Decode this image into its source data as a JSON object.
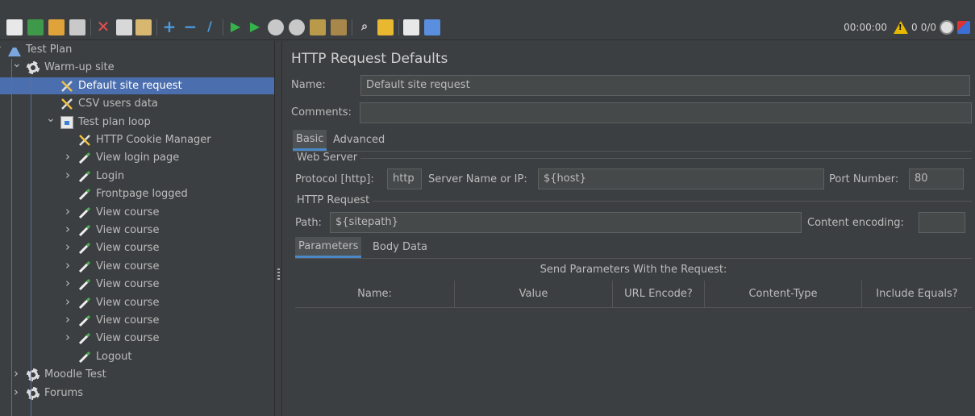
{
  "toolbar": {
    "buttons": [
      "new-icon",
      "templates-icon",
      "open-icon",
      "save-icon",
      "cut-icon",
      "copy-icon",
      "paste-icon",
      "expand-icon",
      "collapse-icon",
      "toggle-icon",
      "start-icon",
      "start-no-pause-icon",
      "stop-icon",
      "shutdown-icon",
      "clear-icon",
      "clear-all-icon",
      "search-icon",
      "reset-search-icon",
      "function-helper-icon",
      "help-icon"
    ],
    "timer": "00:00:00",
    "warnings": "0",
    "threads": "0/0"
  },
  "tree": {
    "items": [
      {
        "label": "Test Plan",
        "icon": "flask-icon",
        "level": 0,
        "arrow": "down"
      },
      {
        "label": "Warm-up site",
        "icon": "gear-icon",
        "level": 1,
        "arrow": "down"
      },
      {
        "label": "Default site request",
        "icon": "tools-icon",
        "level": 2,
        "arrow": "",
        "selected": true
      },
      {
        "label": "CSV users data",
        "icon": "tools-icon",
        "level": 2,
        "arrow": ""
      },
      {
        "label": "Test plan loop",
        "icon": "loop-icon",
        "level": 2,
        "arrow": "down"
      },
      {
        "label": "HTTP Cookie Manager",
        "icon": "tools-icon",
        "level": 3,
        "arrow": ""
      },
      {
        "label": "View login page",
        "icon": "pencil-icon",
        "level": 3,
        "arrow": "right"
      },
      {
        "label": "Login",
        "icon": "pencil-icon",
        "level": 3,
        "arrow": "right"
      },
      {
        "label": "Frontpage logged",
        "icon": "pencil-icon",
        "level": 3,
        "arrow": ""
      },
      {
        "label": "View course",
        "icon": "pencil-icon",
        "level": 3,
        "arrow": "right"
      },
      {
        "label": "View course",
        "icon": "pencil-icon",
        "level": 3,
        "arrow": "right"
      },
      {
        "label": "View course",
        "icon": "pencil-icon",
        "level": 3,
        "arrow": "right"
      },
      {
        "label": "View course",
        "icon": "pencil-icon",
        "level": 3,
        "arrow": "right"
      },
      {
        "label": "View course",
        "icon": "pencil-icon",
        "level": 3,
        "arrow": "right"
      },
      {
        "label": "View course",
        "icon": "pencil-icon",
        "level": 3,
        "arrow": "right"
      },
      {
        "label": "View course",
        "icon": "pencil-icon",
        "level": 3,
        "arrow": "right"
      },
      {
        "label": "View course",
        "icon": "pencil-icon",
        "level": 3,
        "arrow": "right"
      },
      {
        "label": "Logout",
        "icon": "pencil-icon",
        "level": 3,
        "arrow": ""
      },
      {
        "label": "Moodle Test",
        "icon": "gear-icon",
        "level": 1,
        "arrow": "right"
      },
      {
        "label": "Forums",
        "icon": "gear-icon",
        "level": 1,
        "arrow": "right"
      }
    ]
  },
  "panel": {
    "title": "HTTP Request Defaults",
    "name_label": "Name:",
    "name_value": "Default site request",
    "comments_label": "Comments:",
    "comments_value": "",
    "tabs": [
      "Basic",
      "Advanced"
    ],
    "web_server_group": "Web Server",
    "protocol_label": "Protocol [http]:",
    "protocol_value": "http",
    "server_label": "Server Name or IP:",
    "server_value": "${host}",
    "port_label": "Port Number:",
    "port_value": "80",
    "http_request_group": "HTTP Request",
    "path_label": "Path:",
    "path_value": "${sitepath}",
    "encoding_label": "Content encoding:",
    "encoding_value": "",
    "subtabs": [
      "Parameters",
      "Body Data"
    ],
    "table_caption": "Send Parameters With the Request:",
    "columns": [
      "Name:",
      "Value",
      "URL Encode?",
      "Content-Type",
      "Include Equals?"
    ]
  },
  "colors": {
    "background": "#3c3f41",
    "selection": "#4b6eaf",
    "tab_accent": "#4a88c7",
    "field_bg": "#45494a"
  }
}
